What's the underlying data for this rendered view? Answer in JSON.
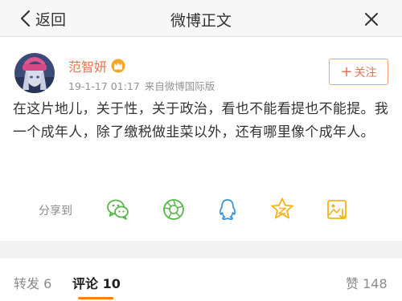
{
  "nav": {
    "back_label": "返回",
    "title": "微博正文"
  },
  "post": {
    "username": "范智妍",
    "timestamp": "19-1-17 01:17",
    "source": "来自微博国际版",
    "follow_label": "关注",
    "text": "在这片地儿，关于性，关于政治，看也不能看提也不能提。我一个成年人，除了缴税做韭菜以外，还有哪里像个成年人。"
  },
  "share": {
    "label": "分享到",
    "targets": [
      "wechat-icon",
      "moments-icon",
      "qq-icon",
      "qzone-icon",
      "image-share-icon"
    ]
  },
  "tabs": {
    "repost": "转发 6",
    "comment": "评论 10",
    "like": "赞 148"
  },
  "colors": {
    "accent": "#eb7350",
    "tab_underline": "#ff8200",
    "share_green": "#57b649",
    "share_blue": "#3a8fd6",
    "share_yellow": "#f5b318"
  }
}
